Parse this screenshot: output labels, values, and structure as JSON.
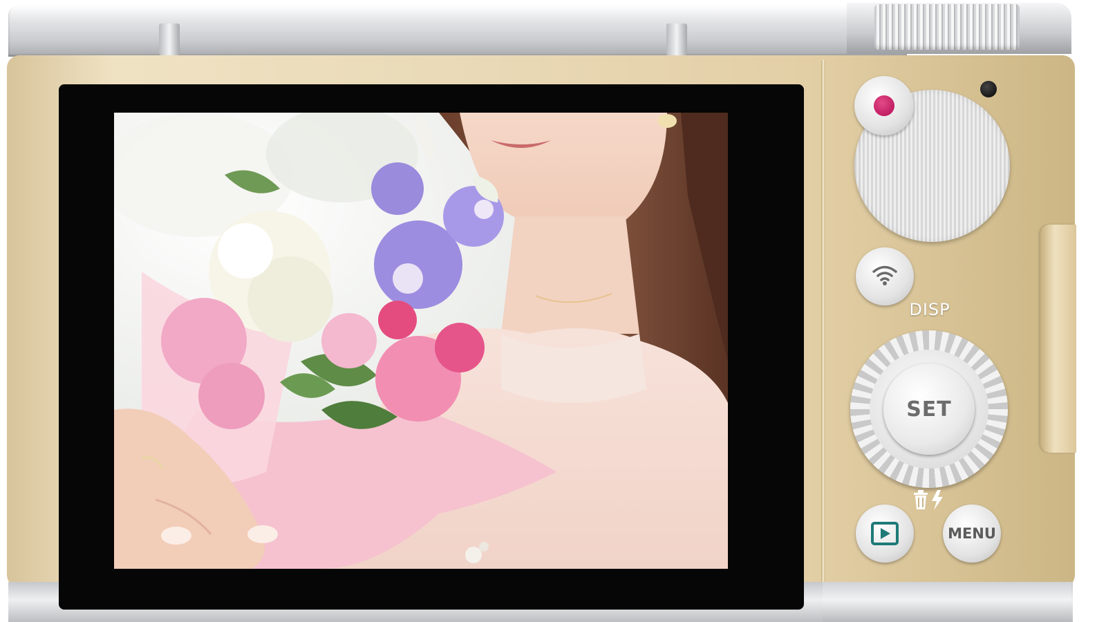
{
  "camera": {
    "buttons": {
      "disp_label": "DISP",
      "set_label": "SET",
      "menu_label": "MENU"
    },
    "icons": {
      "record": "record-dot-icon",
      "wifi": "wifi-icon",
      "trash": "trash-icon",
      "flash": "flash-icon",
      "playback": "playback-icon"
    },
    "colors": {
      "body_gold": "#e9d9b6",
      "trim_silver": "#c9cbce",
      "record_magenta": "#c2105f",
      "playback_teal": "#1f7a78",
      "screen_bezel": "#060606"
    }
  }
}
